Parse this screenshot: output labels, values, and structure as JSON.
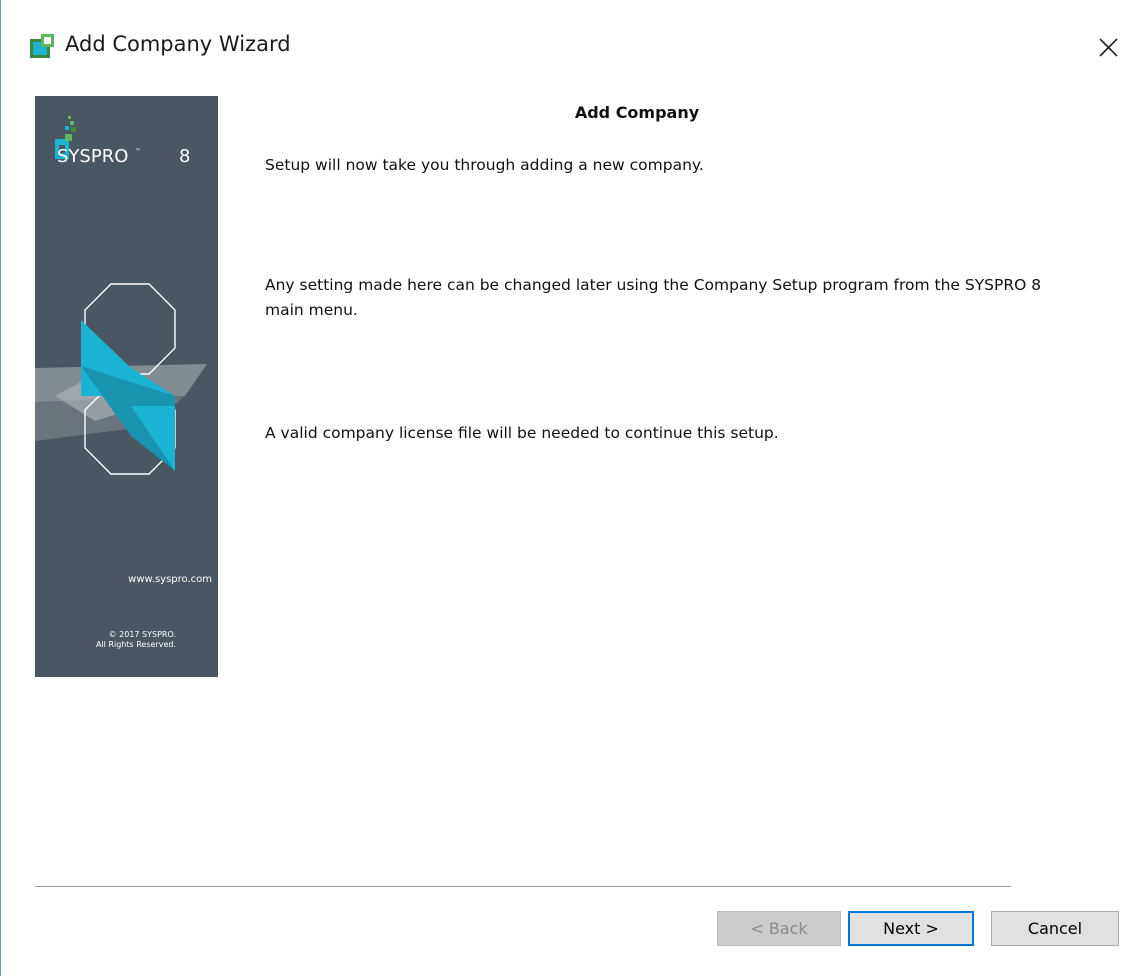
{
  "window": {
    "title": "Add Company Wizard",
    "icon": "syspro-app-icon",
    "close_icon": "close-icon"
  },
  "banner": {
    "brand": "SYSPRO",
    "brand_tm": "™",
    "brand_version": "8",
    "url": "www.syspro.com",
    "copyright_line1": "© 2017 SYSPRO.",
    "copyright_line2": "All Rights Reserved.",
    "colors": {
      "background": "#4a5661",
      "accent": "#1ab3d4"
    }
  },
  "content": {
    "heading": "Add Company",
    "para1": "Setup will now take you through adding a new company.",
    "para2_line1": "Any setting made here can be changed later using the Company Setup program from the SYSPRO 8",
    "para2_line2": "main menu.",
    "para3": "A valid company license file will be needed to continue this setup."
  },
  "buttons": {
    "back": "< Back",
    "next": "Next >",
    "cancel": "Cancel"
  }
}
